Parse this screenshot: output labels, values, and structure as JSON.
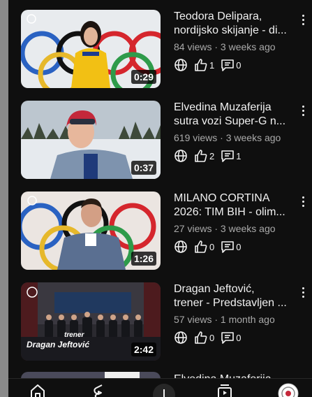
{
  "videos": [
    {
      "title": "Teodora Delipara, nordijsko skijanje - di...",
      "views": "84 views",
      "age": "3 weeks ago",
      "likes": "1",
      "comments": "0",
      "duration": "0:29"
    },
    {
      "title": "Elvedina Muzaferija sutra vozi Super-G n...",
      "views": "619 views",
      "age": "3 weeks ago",
      "likes": "2",
      "comments": "1",
      "duration": "0:37"
    },
    {
      "title": "MILANO CORTINA 2026: TIM BIH - olim...",
      "views": "27 views",
      "age": "3 weeks ago",
      "likes": "0",
      "comments": "0",
      "duration": "1:26"
    },
    {
      "title": "Dragan Jeftović, trener - Predstavljen ...",
      "views": "57 views",
      "age": "1 month ago",
      "likes": "0",
      "comments": "0",
      "duration": "2:42",
      "overlay_small": "trener",
      "overlay_big": "Dragan Jeftović"
    }
  ],
  "partial": {
    "title": "Elvedina Muzaferija"
  },
  "separator": " · ",
  "icons": {
    "visibility": "globe-icon",
    "like": "thumbs-up-icon",
    "comment": "comment-icon",
    "more": "more-vert-icon"
  },
  "nav": [
    "home-icon",
    "shorts-icon",
    "create-icon",
    "subscriptions-icon",
    "you-icon"
  ],
  "colors": {
    "background": "#0f0f0f",
    "text": "#f1f1f1",
    "meta": "#aaaaaa"
  }
}
